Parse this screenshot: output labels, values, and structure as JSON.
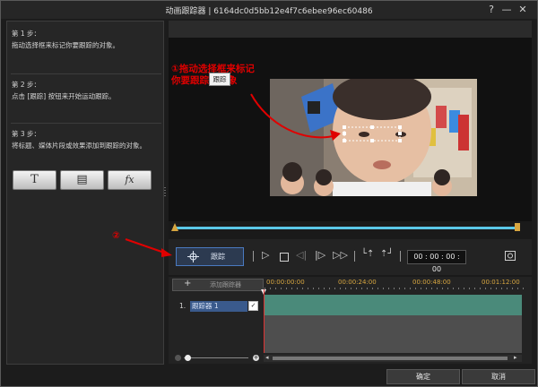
{
  "window": {
    "title": "动画跟踪器  |  6164dc0d5bb12e4f7c6ebee96ec60486",
    "help_icon": "?",
    "minimize_icon": "—",
    "close_icon": "✕"
  },
  "steps": [
    {
      "title": "第 1 步：",
      "desc": "拖动选择框来标记你要跟踪的对象。"
    },
    {
      "title": "第 2 步：",
      "desc": "点击 [跟踪] 按钮来开始运动跟踪。"
    },
    {
      "title": "第 3 步：",
      "desc": "将标题、媒体片段或效果添加到跟踪的对象。"
    }
  ],
  "tool_buttons": {
    "title_icon": "T",
    "media_icon": "▤",
    "fx_icon": "fx"
  },
  "annotations": {
    "marker1": "①",
    "line1": "拖动选择框来标记",
    "line2": "你要跟踪的对象",
    "marker2": "②"
  },
  "controls": {
    "track_label": "跟踪",
    "time": "00 : 00 : 00 : 00",
    "tooltip": "跟踪"
  },
  "timeline": {
    "add_label": "添加跟踪器",
    "ticks": [
      "00:00:00:00",
      "00:00:24:00",
      "00:00:48:00",
      "00:01:12:00"
    ],
    "track_number": "1.",
    "track_name": "跟踪器 1",
    "track_checked": "✓"
  },
  "footer": {
    "ok": "确定",
    "cancel": "取消"
  },
  "colors": {
    "accent": "#5bc8e8",
    "annotation": "#e00000",
    "track": "#4a8a7a"
  }
}
